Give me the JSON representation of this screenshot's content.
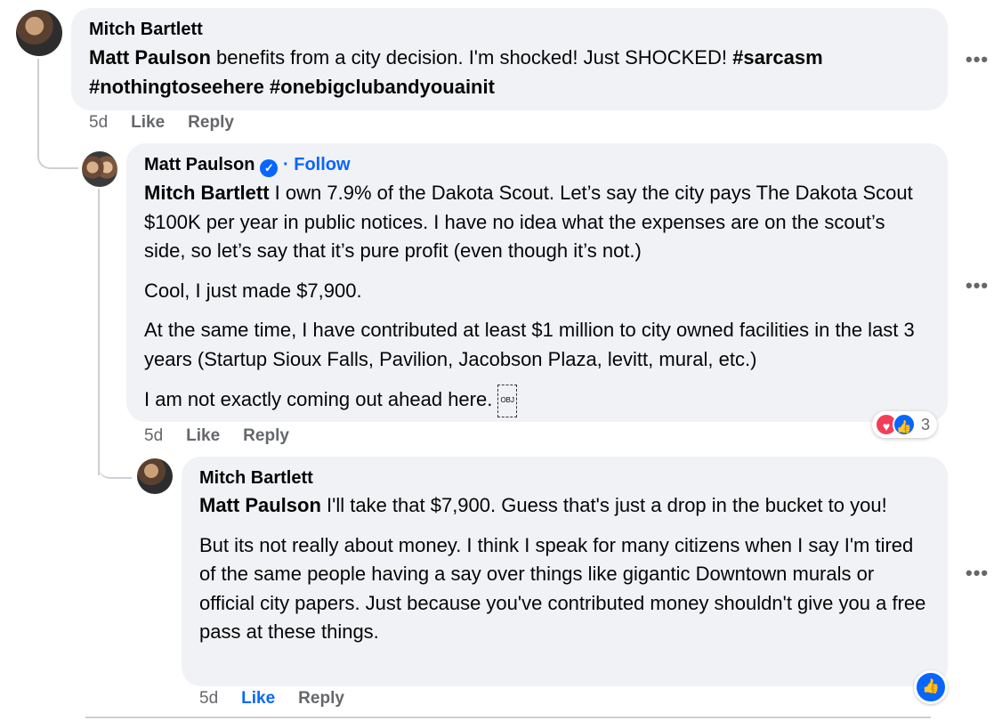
{
  "comments": [
    {
      "author": "Mitch Bartlett",
      "mention": "Matt Paulson",
      "text": " benefits from a city decision. I'm shocked! Just SHOCKED! ",
      "hashtags": "#sarcasm #nothingtoseehere #onebigclubandyouainit",
      "time": "5d",
      "like_label": "Like",
      "reply_label": "Reply"
    },
    {
      "author": "Matt Paulson",
      "verified_icon": "verified-badge-icon",
      "follow_label": "· Follow",
      "mention": "Mitch Bartlett",
      "p1": " I own 7.9% of the Dakota Scout. Let’s say the city pays The Dakota Scout $100K per year in public notices. I have no idea what the expenses are on the scout’s side, so let’s say that it’s pure profit (even though it’s not.)",
      "p2": "Cool, I just made $7,900.",
      "p3": "At the same time, I have contributed at least $1 million to city owned facilities in the last 3 years (Startup Sioux Falls, Pavilion, Jacobson Plaza, levitt, mural, etc.)",
      "p4": "I am not exactly coming out ahead here. ",
      "obj_glyph": "OBJ",
      "reaction_count": "3",
      "time": "5d",
      "like_label": "Like",
      "reply_label": "Reply"
    },
    {
      "author": "Mitch Bartlett",
      "mention": "Matt Paulson",
      "p1": " I'll take that $7,900. Guess that's just a drop in the bucket to you!",
      "p2": "But its not really about money. I think I speak for many citizens when I say I'm tired of the same people having a say over things like gigantic Downtown murals or official city papers. Just because you've contributed money shouldn't give you a free pass at these things.",
      "time": "5d",
      "like_label": "Like",
      "reply_label": "Reply"
    }
  ],
  "more_glyph": "•••",
  "colors": {
    "accent": "#0866ff",
    "bubble": "#f0f2f5",
    "muted": "#65676b",
    "heart": "#f33e58"
  }
}
